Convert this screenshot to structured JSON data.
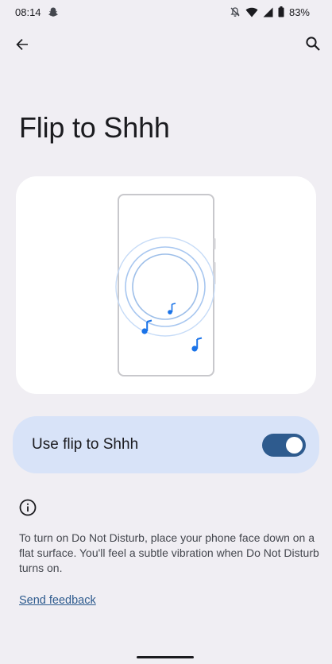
{
  "status_bar": {
    "time": "08:14",
    "battery": "83%",
    "icons": [
      "snapchat-icon",
      "bell-off-icon",
      "wifi-icon",
      "signal-icon",
      "battery-icon"
    ]
  },
  "app_bar": {
    "back_icon": "arrow-back-icon",
    "search_icon": "search-icon"
  },
  "page": {
    "title": "Flip to Shhh"
  },
  "setting": {
    "label": "Use flip to Shhh",
    "enabled": true
  },
  "info": {
    "icon": "info-icon",
    "description": "To turn on Do Not Disturb, place your phone face down on a flat surface. You'll feel a subtle vibration when Do Not Disturb turns on."
  },
  "links": {
    "feedback": "Send feedback"
  },
  "colors": {
    "background": "#f0eef3",
    "card": "#ffffff",
    "toggle_card": "#d8e3f8",
    "accent": "#2e5b8e",
    "note_blue": "#1a73e8"
  }
}
